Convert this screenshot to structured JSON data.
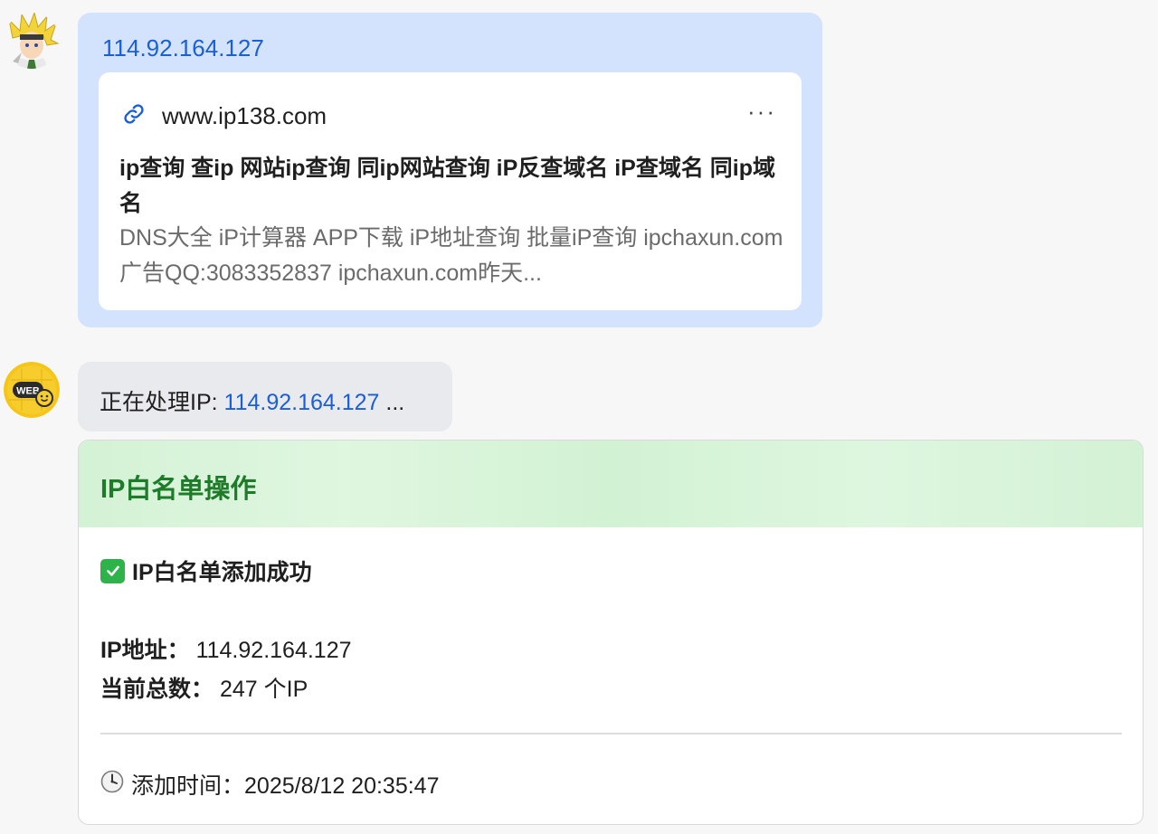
{
  "user_message": {
    "link_text": "114.92.164.127",
    "preview": {
      "domain": "www.ip138.com",
      "more_label": "···",
      "title": "ip查询 查ip 网站ip查询 同ip网站查询 iP反查域名 iP查域名 同ip域名",
      "description": "DNS大全 iP计算器 APP下载 iP地址查询 批量iP查询 ipchaxun.com 广告QQ:3083352837 ipchaxun.com昨天..."
    }
  },
  "bot_message": {
    "prefix": "正在处理IP: ",
    "ip": "114.92.164.127",
    "suffix": " ..."
  },
  "result_card": {
    "title": "IP白名单操作",
    "success_text": "IP白名单添加成功",
    "fields": {
      "ip_label": "IP地址：",
      "ip_value": "114.92.164.127",
      "count_label": "当前总数：",
      "count_value": "247 个IP"
    },
    "time_label": "添加时间：",
    "time_value": "2025/8/12 20:35:47"
  },
  "icons": {
    "link": "link-icon",
    "check": "check-mark-icon",
    "clock": "clock-icon"
  },
  "colors": {
    "accent_link": "#1a5fd8",
    "user_bubble": "#d3e3fd",
    "bot_bubble": "#e9eaed",
    "success_green": "#1e7b2a"
  }
}
